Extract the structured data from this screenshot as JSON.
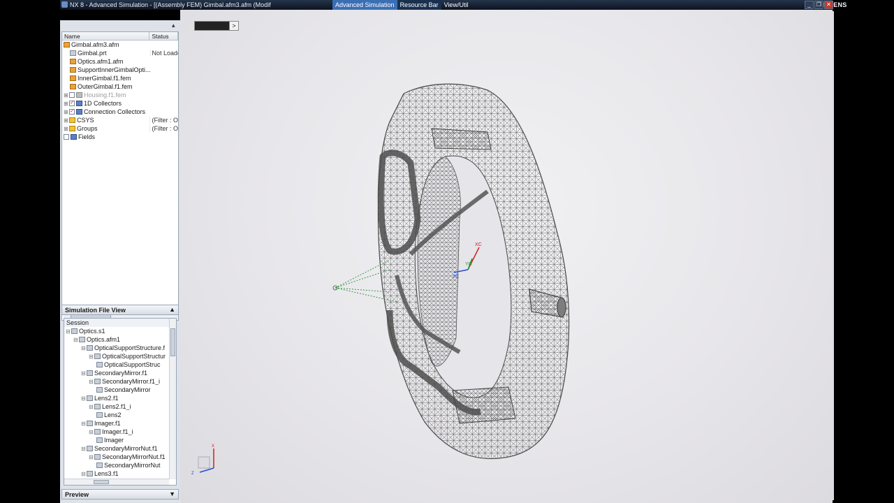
{
  "window": {
    "title": "NX 8 - Advanced Simulation - [(Assembly FEM) Gimbal.afm3.afm (Modif",
    "brand": "SIEMENS",
    "controls": [
      "_",
      "❐",
      "✕"
    ]
  },
  "ribbon_tabs": [
    "Advanced Simulation",
    "Resource Bar",
    "View/Util"
  ],
  "toolbar": {
    "icons": [
      "fem-file-icon",
      "assembly-nav-icon",
      "tree-icon",
      "connection-icon",
      "mesh-mate-icon",
      "constraint-icon",
      "load-icon",
      "solve-icon",
      "results-icon",
      "clock-icon",
      "report-icon",
      "palette-icon",
      "users-icon",
      "folder-open-icon",
      "folder-new-icon",
      "save-icon",
      "check-fix-icon",
      "undo-icon",
      "checkmark-icon"
    ]
  },
  "part_navigator": {
    "columns": [
      "Name",
      "Status"
    ],
    "rows": [
      {
        "name": "Gimbal.afm3.afm",
        "status": "",
        "indent": 0,
        "icon": "doc"
      },
      {
        "name": "Gimbal.prt",
        "status": "Not Loade",
        "indent": 1,
        "icon": "part"
      },
      {
        "name": "Optics.afm1.afm",
        "status": "",
        "indent": 1,
        "icon": "doc"
      },
      {
        "name": "SupportInnerGimbalOpti...",
        "status": "",
        "indent": 1,
        "icon": "doc"
      },
      {
        "name": "InnerGimbal.f1.fem",
        "status": "",
        "indent": 1,
        "icon": "doc"
      },
      {
        "name": "OuterGimbal.f1.fem",
        "status": "",
        "indent": 1,
        "icon": "doc"
      },
      {
        "name": "Housing.f1.fem",
        "status": "",
        "indent": 0,
        "icon": "grey"
      },
      {
        "name": "1D Collectors",
        "status": "",
        "indent": 0,
        "icon": "blue"
      },
      {
        "name": "Connection Collectors",
        "status": "",
        "indent": 0,
        "icon": "blue"
      },
      {
        "name": "CSYS",
        "status": "(Filter : Ol",
        "indent": 0,
        "icon": "fold"
      },
      {
        "name": "Groups",
        "status": "(Filter : Ol",
        "indent": 0,
        "icon": "fold"
      },
      {
        "name": "Fields",
        "status": "",
        "indent": 0,
        "icon": "blue"
      }
    ]
  },
  "sim_file_view": {
    "title": "Simulation File View",
    "root": "Session",
    "rows": [
      {
        "name": "Optics.s1",
        "indent": 0
      },
      {
        "name": "Optics.afm1",
        "indent": 1
      },
      {
        "name": "OpticalSupportStructure.f",
        "indent": 2
      },
      {
        "name": "OpticalSupportStructur",
        "indent": 3
      },
      {
        "name": "OpticalSupportStruc",
        "indent": 4
      },
      {
        "name": "SecondaryMirror.f1",
        "indent": 2
      },
      {
        "name": "SecondaryMirror.f1_i",
        "indent": 3
      },
      {
        "name": "SecondaryMirror",
        "indent": 4
      },
      {
        "name": "Lens2.f1",
        "indent": 2
      },
      {
        "name": "Lens2.f1_i",
        "indent": 3
      },
      {
        "name": "Lens2",
        "indent": 4
      },
      {
        "name": "Imager.f1",
        "indent": 2
      },
      {
        "name": "Imager.f1_i",
        "indent": 3
      },
      {
        "name": "Imager",
        "indent": 4
      },
      {
        "name": "SecondaryMirrorNut.f1",
        "indent": 2
      },
      {
        "name": "SecondaryMirrorNut.f1",
        "indent": 3
      },
      {
        "name": "SecondaryMirrorNut",
        "indent": 4
      },
      {
        "name": "Lens3.f1",
        "indent": 2
      }
    ]
  },
  "preview": {
    "title": "Preview"
  },
  "viewport": {
    "triad_labels": {
      "x": "XC",
      "y": "YC",
      "z": "ZC"
    },
    "mini_triad": {
      "x": "X",
      "y": "Y",
      "z": "Z"
    },
    "model": "gimbal-mesh"
  },
  "colors": {
    "title_bar": "#1a2638",
    "mesh": "#5a5a5a",
    "viewport_bg": "#e8e7eb"
  }
}
